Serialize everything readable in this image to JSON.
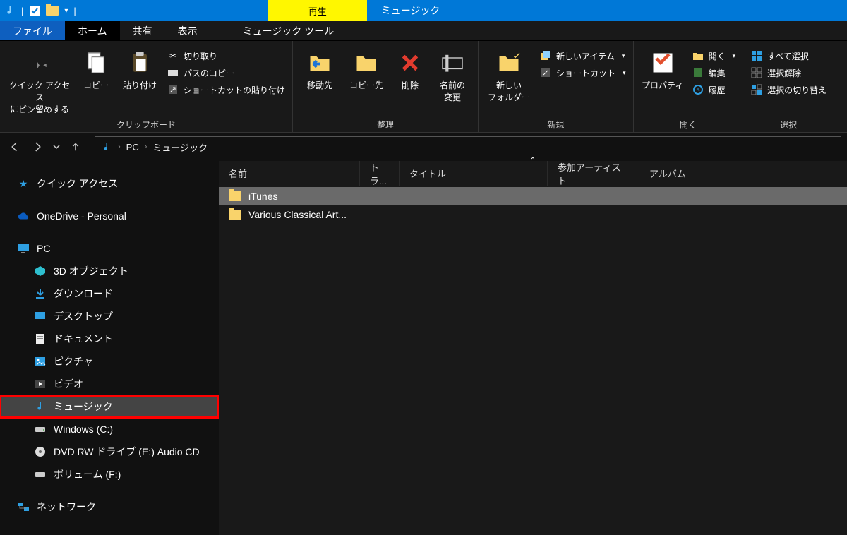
{
  "titlebar": {
    "tool_tab": "再生",
    "window_title": "ミュージック"
  },
  "tabs": {
    "file": "ファイル",
    "home": "ホーム",
    "share": "共有",
    "view": "表示",
    "music_tools": "ミュージック ツール"
  },
  "ribbon": {
    "clipboard": {
      "pin": "クイック アクセス\nにピン留めする",
      "copy": "コピー",
      "paste": "貼り付け",
      "cut": "切り取り",
      "copy_path": "パスのコピー",
      "paste_shortcut": "ショートカットの貼り付け",
      "label": "クリップボード"
    },
    "organize": {
      "move_to": "移動先",
      "copy_to": "コピー先",
      "delete": "削除",
      "rename": "名前の\n変更",
      "label": "整理"
    },
    "new_": {
      "new_folder": "新しい\nフォルダー",
      "new_item": "新しいアイテム",
      "shortcut": "ショートカット",
      "label": "新規"
    },
    "open": {
      "properties": "プロパティ",
      "open_btn": "開く",
      "edit": "編集",
      "history": "履歴",
      "label": "開く"
    },
    "select": {
      "select_all": "すべて選択",
      "select_none": "選択解除",
      "invert": "選択の切り替え",
      "label": "選択"
    }
  },
  "breadcrumb": {
    "root": "PC",
    "current": "ミュージック"
  },
  "sidebar": {
    "quick_access": "クイック アクセス",
    "onedrive": "OneDrive - Personal",
    "pc": "PC",
    "objects3d": "3D オブジェクト",
    "downloads": "ダウンロード",
    "desktop": "デスクトップ",
    "documents": "ドキュメント",
    "pictures": "ピクチャ",
    "videos": "ビデオ",
    "music": "ミュージック",
    "drive_c": "Windows (C:)",
    "drive_e": "DVD RW ドライブ (E:) Audio CD",
    "drive_f": "ボリューム (F:)",
    "network": "ネットワーク"
  },
  "columns": {
    "name": "名前",
    "track": "トラ...",
    "title": "タイトル",
    "artist": "参加アーティスト",
    "album": "アルバム"
  },
  "files": [
    {
      "name": "iTunes",
      "selected": true
    },
    {
      "name": "Various Classical Art...",
      "selected": false
    }
  ]
}
